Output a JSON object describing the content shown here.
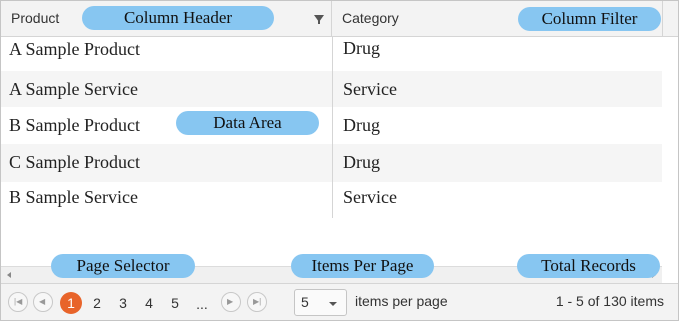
{
  "grid": {
    "columns": [
      {
        "title": "Product"
      },
      {
        "title": "Category"
      }
    ],
    "rows": [
      {
        "product": "A Sample Product",
        "category": "Drug"
      },
      {
        "product": "A Sample Service",
        "category": "Service"
      },
      {
        "product": "B Sample Product",
        "category": "Drug"
      },
      {
        "product": "C Sample Product",
        "category": "Drug"
      },
      {
        "product": "B Sample Service",
        "category": "Service"
      }
    ]
  },
  "icons": {
    "product_filter": "filter-icon",
    "category_filter": "filter-icon-active"
  },
  "pager": {
    "first_glyph": "|◀",
    "prev_glyph": "◀",
    "next_glyph": "▶",
    "last_glyph": "▶|",
    "pages": [
      "1",
      "2",
      "3",
      "4",
      "5"
    ],
    "active_page": "1",
    "ellipsis": "...",
    "page_size": "5",
    "items_per_page_label": "items per page",
    "total_label": "1 - 5 of 130 items"
  },
  "callouts": {
    "column_header": "Column Header",
    "column_filter": "Column Filter",
    "data_area": "Data Area",
    "page_selector": "Page Selector",
    "items_per_page": "Items Per Page",
    "total_records": "Total Records"
  },
  "colors": {
    "accent_active_page": "#e8642a",
    "callout_bg": "#87c6f1",
    "active_filter": "#2e6fb5"
  }
}
